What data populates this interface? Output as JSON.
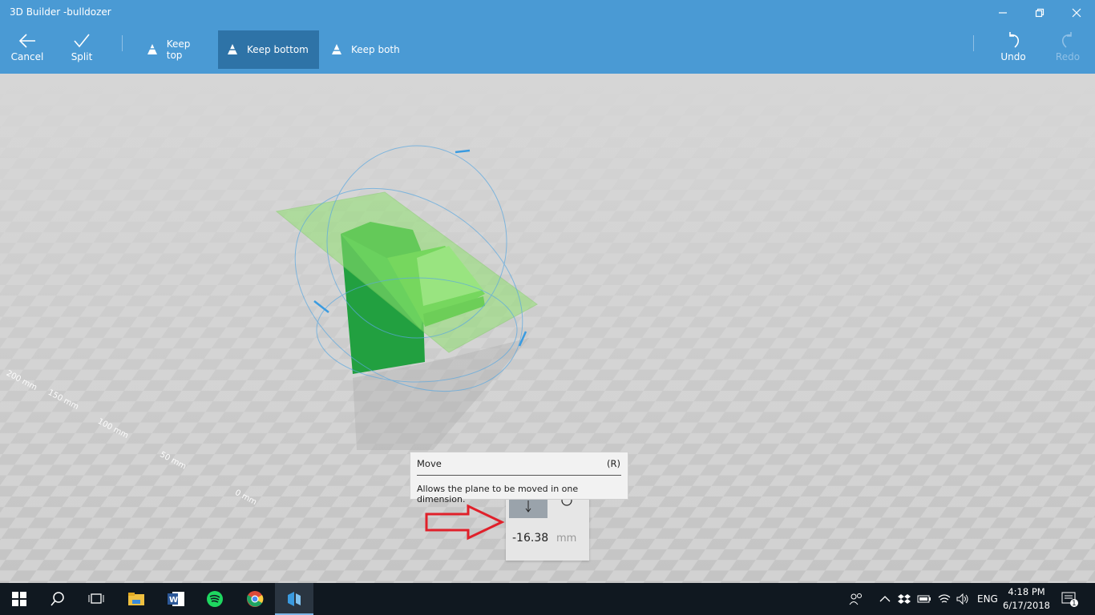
{
  "window": {
    "title": "3D Builder -bulldozer"
  },
  "toolbar": {
    "cancel_label": "Cancel",
    "split_label": "Split",
    "options": [
      {
        "label": "Keep top",
        "selected": false
      },
      {
        "label": "Keep bottom",
        "selected": true
      },
      {
        "label": "Keep both",
        "selected": false
      }
    ],
    "undo_label": "Undo",
    "redo_label": "Redo"
  },
  "viewport": {
    "ruler_labels": [
      "0 mm",
      "50 mm",
      "100 mm",
      "150 mm",
      "200 mm"
    ],
    "model_color": "#3cba3c",
    "plane_color": "#90e070"
  },
  "tooltip": {
    "title": "Move",
    "shortcut": "(R)",
    "description": "Allows the plane to be moved in one dimension."
  },
  "move_panel": {
    "value": "-16.38",
    "unit": "mm"
  },
  "taskbar": {
    "apps": [
      "start-icon",
      "search-icon",
      "task-view-icon",
      "file-explorer-icon",
      "word-icon",
      "spotify-icon",
      "chrome-icon",
      "3d-builder-icon"
    ],
    "language": "ENG",
    "time": "4:18 PM",
    "date": "6/17/2018",
    "notification_count": "1"
  },
  "colors": {
    "accent": "#4a9ad4",
    "accent_dark": "#2e73a7",
    "taskbar": "#101820",
    "arrow": "#e0202a"
  }
}
